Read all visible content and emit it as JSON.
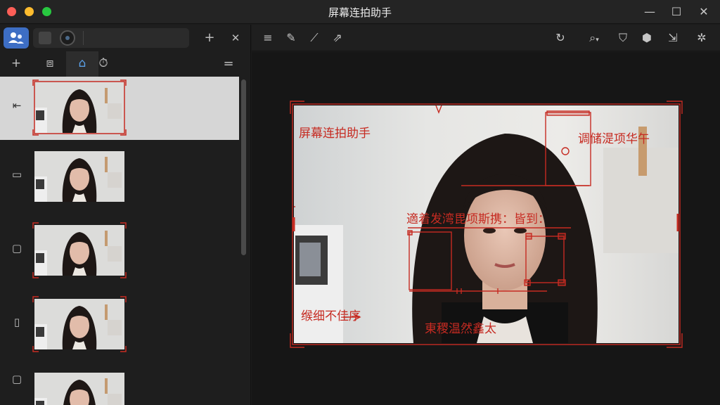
{
  "window": {
    "title": "屏幕连拍助手"
  },
  "window_controls": {
    "minimize": "—",
    "maximize": "☐",
    "close": "✕"
  },
  "left_toolbar": {
    "add": "+",
    "close": "✕",
    "menu": "="
  },
  "left_tabs": [
    {
      "icon": "add-icon",
      "glyph": "+"
    },
    {
      "icon": "capture-box-icon",
      "glyph": "⧈"
    },
    {
      "icon": "home-icon",
      "glyph": "⌂"
    },
    {
      "icon": "timer-icon",
      "glyph": "⏱"
    }
  ],
  "thumbnails": [
    {
      "icon": "collapse-icon",
      "glyph": "⇤",
      "selected": true
    },
    {
      "icon": "tablet-icon",
      "glyph": "▭",
      "selected": false
    },
    {
      "icon": "chat-icon",
      "glyph": "▢",
      "selected": false
    },
    {
      "icon": "document-icon",
      "glyph": "▯",
      "selected": false
    },
    {
      "icon": "chat-icon",
      "glyph": "▢",
      "selected": false
    }
  ],
  "right_toolbar": [
    {
      "icon": "align-left-icon",
      "glyph": "≡"
    },
    {
      "icon": "pencil-icon",
      "glyph": "✎"
    },
    {
      "icon": "eyedropper-icon",
      "glyph": "⟋"
    },
    {
      "icon": "export-icon",
      "glyph": "⇗"
    },
    {
      "icon": "rotate-icon",
      "glyph": "↻"
    },
    {
      "icon": "zoom-icon",
      "glyph": "⌕"
    },
    {
      "icon": "shield-icon",
      "glyph": "⛉"
    },
    {
      "icon": "cube-icon",
      "glyph": "⬢"
    },
    {
      "icon": "share-icon",
      "glyph": "⇲"
    },
    {
      "icon": "settings-icon",
      "glyph": "✲"
    }
  ],
  "annotations": {
    "top_left": "屏幕连拍助手",
    "top_right": "调储湜项华午",
    "middle": "適着发湾毘项斯携：皆到：",
    "bottom_left": "缑细不佳序",
    "bottom_center": "東稷温然鑫太"
  },
  "colors": {
    "accent": "#c62b22",
    "selection_bg": "#d6d6d6",
    "app_badge": "#3d6ec4"
  }
}
